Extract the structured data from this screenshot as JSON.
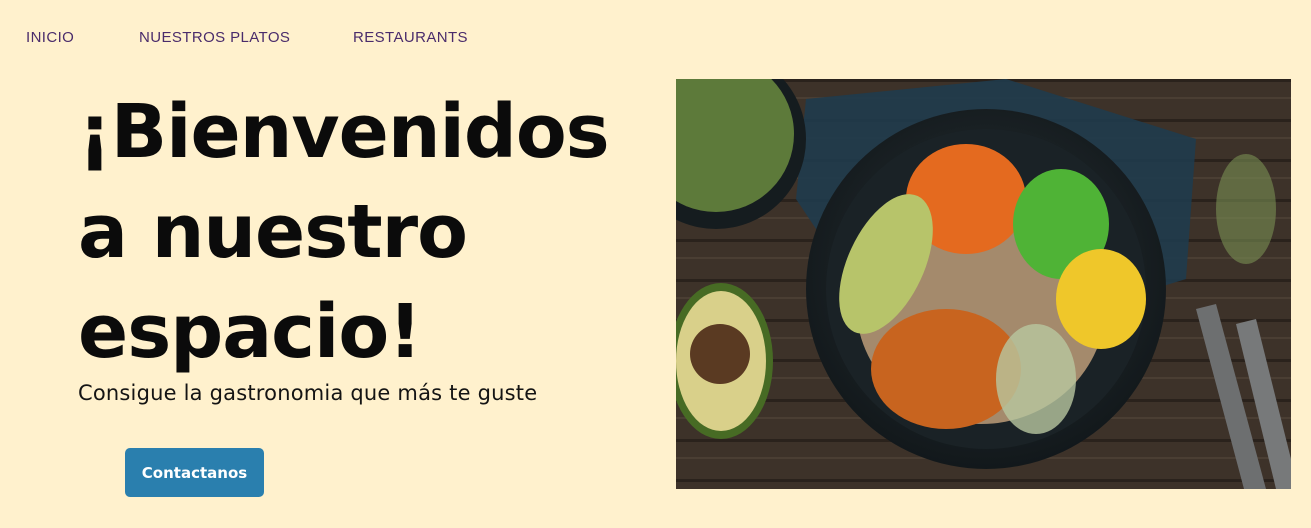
{
  "nav": {
    "items": [
      {
        "label": "INICIO"
      },
      {
        "label": "NUESTROS PLATOS"
      },
      {
        "label": "RESTAURANTS"
      }
    ]
  },
  "hero": {
    "title": "¡Bienvenidos a nuestro espacio!",
    "subtitle": "Consigue la gastronomia que más te guste",
    "cta_label": "Contactanos"
  },
  "colors": {
    "background": "#fff1cd",
    "nav_text": "#4a2c6b",
    "cta": "#2a7fae"
  }
}
